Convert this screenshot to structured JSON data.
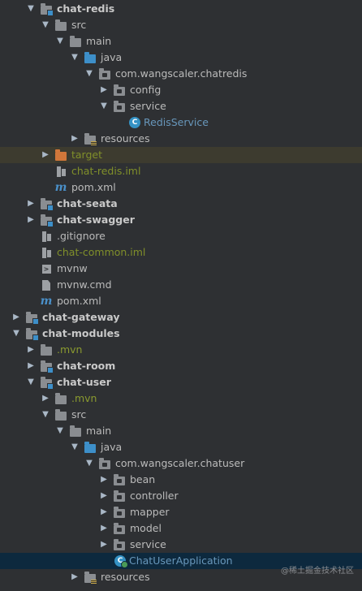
{
  "tree": [
    {
      "label": "chat-redis",
      "style": "bold",
      "icon": "module-folder-icon",
      "arrow": "down"
    },
    {
      "label": "src",
      "style": "white",
      "icon": "folder-icon",
      "arrow": "down"
    },
    {
      "label": "main",
      "style": "white",
      "icon": "folder-icon",
      "arrow": "down"
    },
    {
      "label": "java",
      "style": "white",
      "icon": "source-folder-icon",
      "arrow": "down"
    },
    {
      "label": "com.wangscaler.chatredis",
      "style": "white",
      "icon": "package-icon",
      "arrow": "down"
    },
    {
      "label": "config",
      "style": "white",
      "icon": "package-icon",
      "arrow": "right"
    },
    {
      "label": "service",
      "style": "white",
      "icon": "package-icon",
      "arrow": "down"
    },
    {
      "label": "RedisService",
      "style": "blue",
      "icon": "class-icon",
      "arrow": ""
    },
    {
      "label": "resources",
      "style": "white",
      "icon": "resources-folder-icon",
      "arrow": "right"
    },
    {
      "label": "target",
      "style": "olive",
      "icon": "excluded-folder-icon",
      "arrow": "right"
    },
    {
      "label": "chat-redis.iml",
      "style": "olive",
      "icon": "iml-file-icon",
      "arrow": ""
    },
    {
      "label": "pom.xml",
      "style": "white",
      "icon": "maven-icon",
      "arrow": ""
    },
    {
      "label": "chat-seata",
      "style": "bold",
      "icon": "module-folder-icon",
      "arrow": "right"
    },
    {
      "label": "chat-swagger",
      "style": "bold",
      "icon": "module-folder-icon",
      "arrow": "right"
    },
    {
      "label": ".gitignore",
      "style": "white",
      "icon": "file-icon",
      "arrow": ""
    },
    {
      "label": "chat-common.iml",
      "style": "olive",
      "icon": "iml-file-icon",
      "arrow": ""
    },
    {
      "label": "mvnw",
      "style": "white",
      "icon": "terminal-file-icon",
      "arrow": ""
    },
    {
      "label": "mvnw.cmd",
      "style": "white",
      "icon": "file-icon",
      "arrow": ""
    },
    {
      "label": "pom.xml",
      "style": "white",
      "icon": "maven-icon",
      "arrow": ""
    },
    {
      "label": "chat-gateway",
      "style": "bold",
      "icon": "module-folder-icon",
      "arrow": "right"
    },
    {
      "label": "chat-modules",
      "style": "bold",
      "icon": "module-folder-icon",
      "arrow": "down"
    },
    {
      "label": ".mvn",
      "style": "olive",
      "icon": "folder-icon",
      "arrow": "right"
    },
    {
      "label": "chat-room",
      "style": "bold",
      "icon": "module-folder-icon",
      "arrow": "right"
    },
    {
      "label": "chat-user",
      "style": "bold",
      "icon": "module-folder-icon",
      "arrow": "down"
    },
    {
      "label": ".mvn",
      "style": "olive",
      "icon": "folder-icon",
      "arrow": "right"
    },
    {
      "label": "src",
      "style": "white",
      "icon": "folder-icon",
      "arrow": "down"
    },
    {
      "label": "main",
      "style": "white",
      "icon": "folder-icon",
      "arrow": "down"
    },
    {
      "label": "java",
      "style": "white",
      "icon": "source-folder-icon",
      "arrow": "down"
    },
    {
      "label": "com.wangscaler.chatuser",
      "style": "white",
      "icon": "package-icon",
      "arrow": "down"
    },
    {
      "label": "bean",
      "style": "white",
      "icon": "package-icon",
      "arrow": "right"
    },
    {
      "label": "controller",
      "style": "white",
      "icon": "package-icon",
      "arrow": "right"
    },
    {
      "label": "mapper",
      "style": "white",
      "icon": "package-icon",
      "arrow": "right"
    },
    {
      "label": "model",
      "style": "white",
      "icon": "package-icon",
      "arrow": "right"
    },
    {
      "label": "service",
      "style": "white",
      "icon": "package-icon",
      "arrow": "right"
    },
    {
      "label": "ChatUserApplication",
      "style": "blue",
      "icon": "spring-app-icon",
      "arrow": "",
      "selected": true
    },
    {
      "label": "resources",
      "style": "white",
      "icon": "resources-folder-icon",
      "arrow": "right"
    }
  ],
  "watermark": "@稀土掘金技术社区"
}
